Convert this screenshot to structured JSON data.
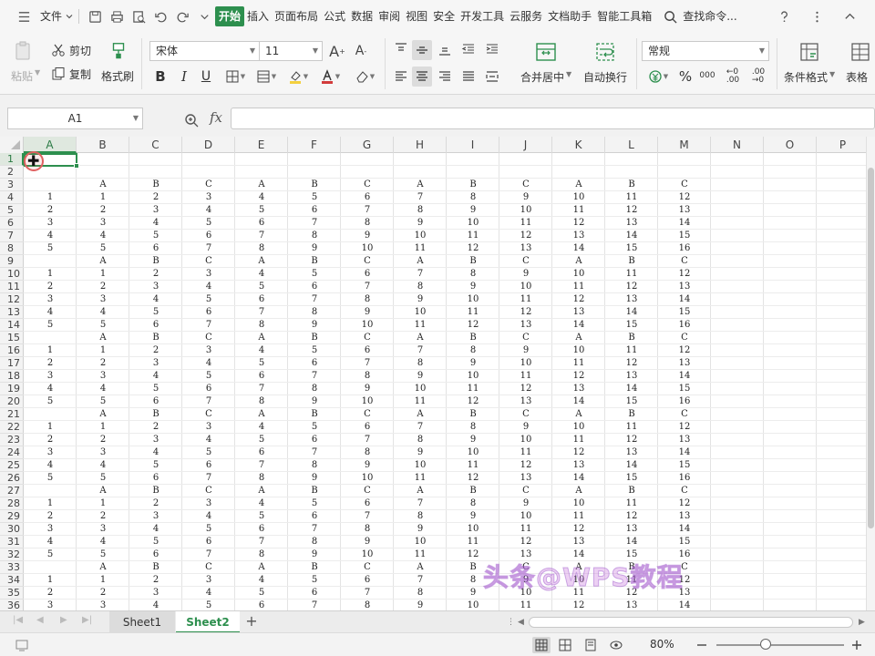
{
  "menubar": {
    "file_label": "文件",
    "tabs": [
      "开始",
      "插入",
      "页面布局",
      "公式",
      "数据",
      "审阅",
      "视图",
      "安全",
      "开发工具",
      "云服务",
      "文档助手",
      "智能工具箱"
    ],
    "active_tab": "开始",
    "search_label": "查找命令..."
  },
  "ribbon": {
    "paste_label": "粘贴",
    "cut_label": "剪切",
    "copy_label": "复制",
    "format_painter_label": "格式刷",
    "font_name": "宋体",
    "font_size": "11",
    "merge_label": "合并居中",
    "wrap_label": "自动换行",
    "number_format": "常规",
    "conditional_label": "条件格式",
    "table_label": "表格"
  },
  "formulabar": {
    "cell_ref": "A1",
    "fx_label": "fx",
    "formula": ""
  },
  "grid": {
    "columns": [
      "A",
      "B",
      "C",
      "D",
      "E",
      "F",
      "G",
      "H",
      "I",
      "J",
      "K",
      "L",
      "M",
      "N",
      "O",
      "P"
    ],
    "rows": [
      "1",
      "2",
      "3",
      "4",
      "5",
      "6",
      "7",
      "8",
      "9",
      "10",
      "11",
      "12",
      "13",
      "14",
      "15",
      "16",
      "17",
      "18",
      "19",
      "20",
      "21",
      "22",
      "23",
      "24",
      "25",
      "26",
      "27",
      "28",
      "29",
      "30",
      "31",
      "32",
      "33",
      "34",
      "35",
      "36"
    ],
    "header_row": [
      "",
      "A",
      "B",
      "C",
      "A",
      "B",
      "C",
      "A",
      "B",
      "C",
      "A",
      "B",
      "C"
    ],
    "data_rows": [
      [
        "1",
        "1",
        "2",
        "3",
        "4",
        "5",
        "6",
        "7",
        "8",
        "9",
        "10",
        "11",
        "12"
      ],
      [
        "2",
        "2",
        "3",
        "4",
        "5",
        "6",
        "7",
        "8",
        "9",
        "10",
        "11",
        "12",
        "13"
      ],
      [
        "3",
        "3",
        "4",
        "5",
        "6",
        "7",
        "8",
        "9",
        "10",
        "11",
        "12",
        "13",
        "14"
      ],
      [
        "4",
        "4",
        "5",
        "6",
        "7",
        "8",
        "9",
        "10",
        "11",
        "12",
        "13",
        "14",
        "15"
      ],
      [
        "5",
        "5",
        "6",
        "7",
        "8",
        "9",
        "10",
        "11",
        "12",
        "13",
        "14",
        "15",
        "16"
      ]
    ],
    "selected_cell": "A1"
  },
  "sheets": {
    "tabs": [
      "Sheet1",
      "Sheet2"
    ],
    "active": "Sheet2"
  },
  "statusbar": {
    "zoom": "80%",
    "zoom_value": 0.8
  },
  "watermark": "头条@WPS教程",
  "colors": {
    "accent": "#2d8f4e",
    "watermark": "#c878dc"
  }
}
